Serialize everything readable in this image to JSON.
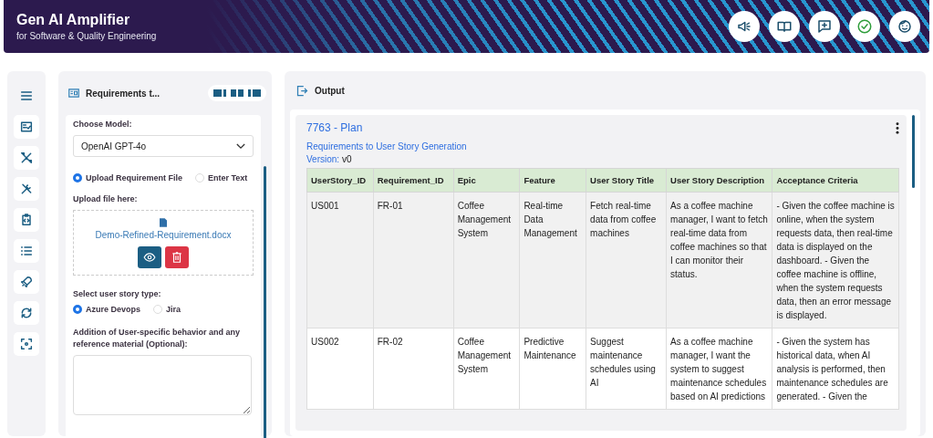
{
  "header": {
    "title": "Gen AI Amplifier",
    "subtitle": "for Software & Quality Engineering"
  },
  "left_panel": {
    "title": "Requirements t...",
    "model_label": "Choose Model:",
    "model_value": "OpenAI GPT-4o",
    "input_modes": [
      {
        "label": "Upload Requirement File",
        "selected": true
      },
      {
        "label": "Enter Text",
        "selected": false
      }
    ],
    "upload_label": "Upload file here:",
    "file_name": "Demo-Refined-Requirement.docx",
    "story_type_label": "Select user story type:",
    "story_types": [
      {
        "label": "Azure Devops",
        "selected": true
      },
      {
        "label": "Jira",
        "selected": false
      }
    ],
    "notes_label": "Addition of User-specific behavior and any reference material (Optional):"
  },
  "output": {
    "title": "Output",
    "card_title": "7763 - Plan",
    "subtitle": "Requirements to User Story Generation",
    "version_label": "Version:",
    "version": "v0",
    "table": {
      "columns": [
        "UserStory_ID",
        "Requirement_ID",
        "Epic",
        "Feature",
        "User Story Title",
        "User Story Description",
        "Acceptance Criteria"
      ],
      "rows": [
        [
          "US001",
          "FR-01",
          "Coffee Management System",
          "Real-time Data Management",
          "Fetch real-time data from coffee machines",
          "As a coffee machine manager, I want to fetch real-time data from coffee machines so that I can monitor their status.",
          "- Given the coffee machine is online, when the system requests data, then real-time data is displayed on the dashboard. - Given the coffee machine is offline, when the system requests data, then an error message is displayed."
        ],
        [
          "US002",
          "FR-02",
          "Coffee Management System",
          "Predictive Maintenance",
          "Suggest maintenance schedules using AI",
          "As a coffee machine manager, I want the system to suggest maintenance schedules based on AI predictions",
          "- Given the system has historical data, when AI analysis is performed, then maintenance schedules are generated. - Given the"
        ]
      ]
    }
  }
}
